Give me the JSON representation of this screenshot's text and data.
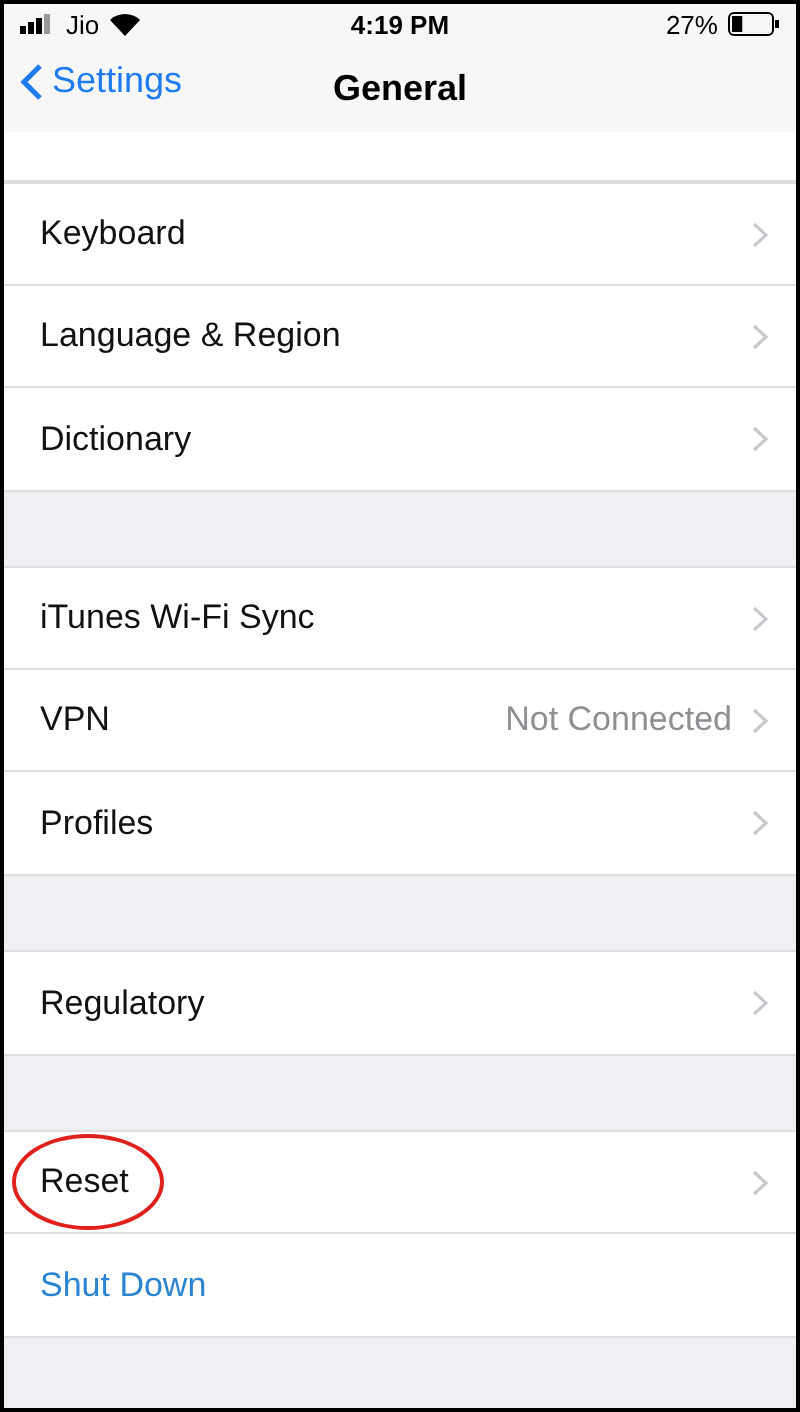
{
  "status_bar": {
    "carrier": "Jio",
    "time": "4:19 PM",
    "battery": "27%"
  },
  "nav": {
    "back": "Settings",
    "title": "General"
  },
  "groups": [
    {
      "rows": [
        {
          "kind": "link",
          "label": "Keyboard",
          "highlighted": false
        },
        {
          "kind": "link",
          "label": "Language & Region",
          "highlighted": false
        },
        {
          "kind": "link",
          "label": "Dictionary",
          "highlighted": false
        }
      ]
    },
    {
      "rows": [
        {
          "kind": "link",
          "label": "iTunes Wi-Fi Sync",
          "highlighted": false
        },
        {
          "kind": "link",
          "label": "VPN",
          "detail": "Not Connected",
          "highlighted": false
        },
        {
          "kind": "link",
          "label": "Profiles",
          "highlighted": false
        }
      ]
    },
    {
      "rows": [
        {
          "kind": "link",
          "label": "Regulatory",
          "highlighted": false
        }
      ]
    },
    {
      "rows": [
        {
          "kind": "link",
          "label": "Reset",
          "highlighted": true
        },
        {
          "kind": "action",
          "label": "Shut Down",
          "highlighted": false
        }
      ]
    }
  ]
}
